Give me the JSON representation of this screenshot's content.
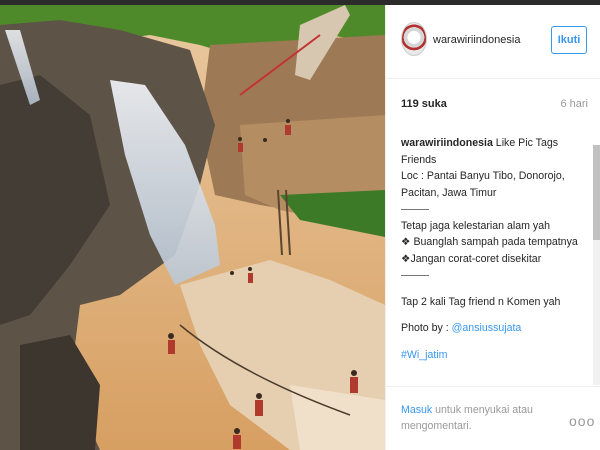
{
  "post": {
    "username": "warawiriindonesia",
    "follow_label": "Ikuti",
    "likes": "119 suka",
    "time": "6 hari",
    "caption_author": "warawiriindonesia",
    "caption_line1": "Like Pic Tags Friends",
    "caption_line2": "Loc : Pantai Banyu Tibo, Donorojo, Pacitan, Jawa Timur",
    "line_keep": "Tetap jaga kelestarian alam yah",
    "line_trash": "❖ Buanglah sampah pada tempatnya",
    "line_graffiti": "❖Jangan corat-coret disekitar",
    "line_tap": "Tap 2 kali Tag friend n Komen yah",
    "photo_by_label": "Photo by : ",
    "photo_by_handle": "@ansiussujata",
    "hashtag": "#Wi_jatim",
    "login_link": "Masuk",
    "login_text": " untuk menyukai atau mengomentari.",
    "more_icon": "ooo"
  },
  "colors": {
    "accent": "#3897f0",
    "muted": "#999999",
    "text": "#262626"
  }
}
